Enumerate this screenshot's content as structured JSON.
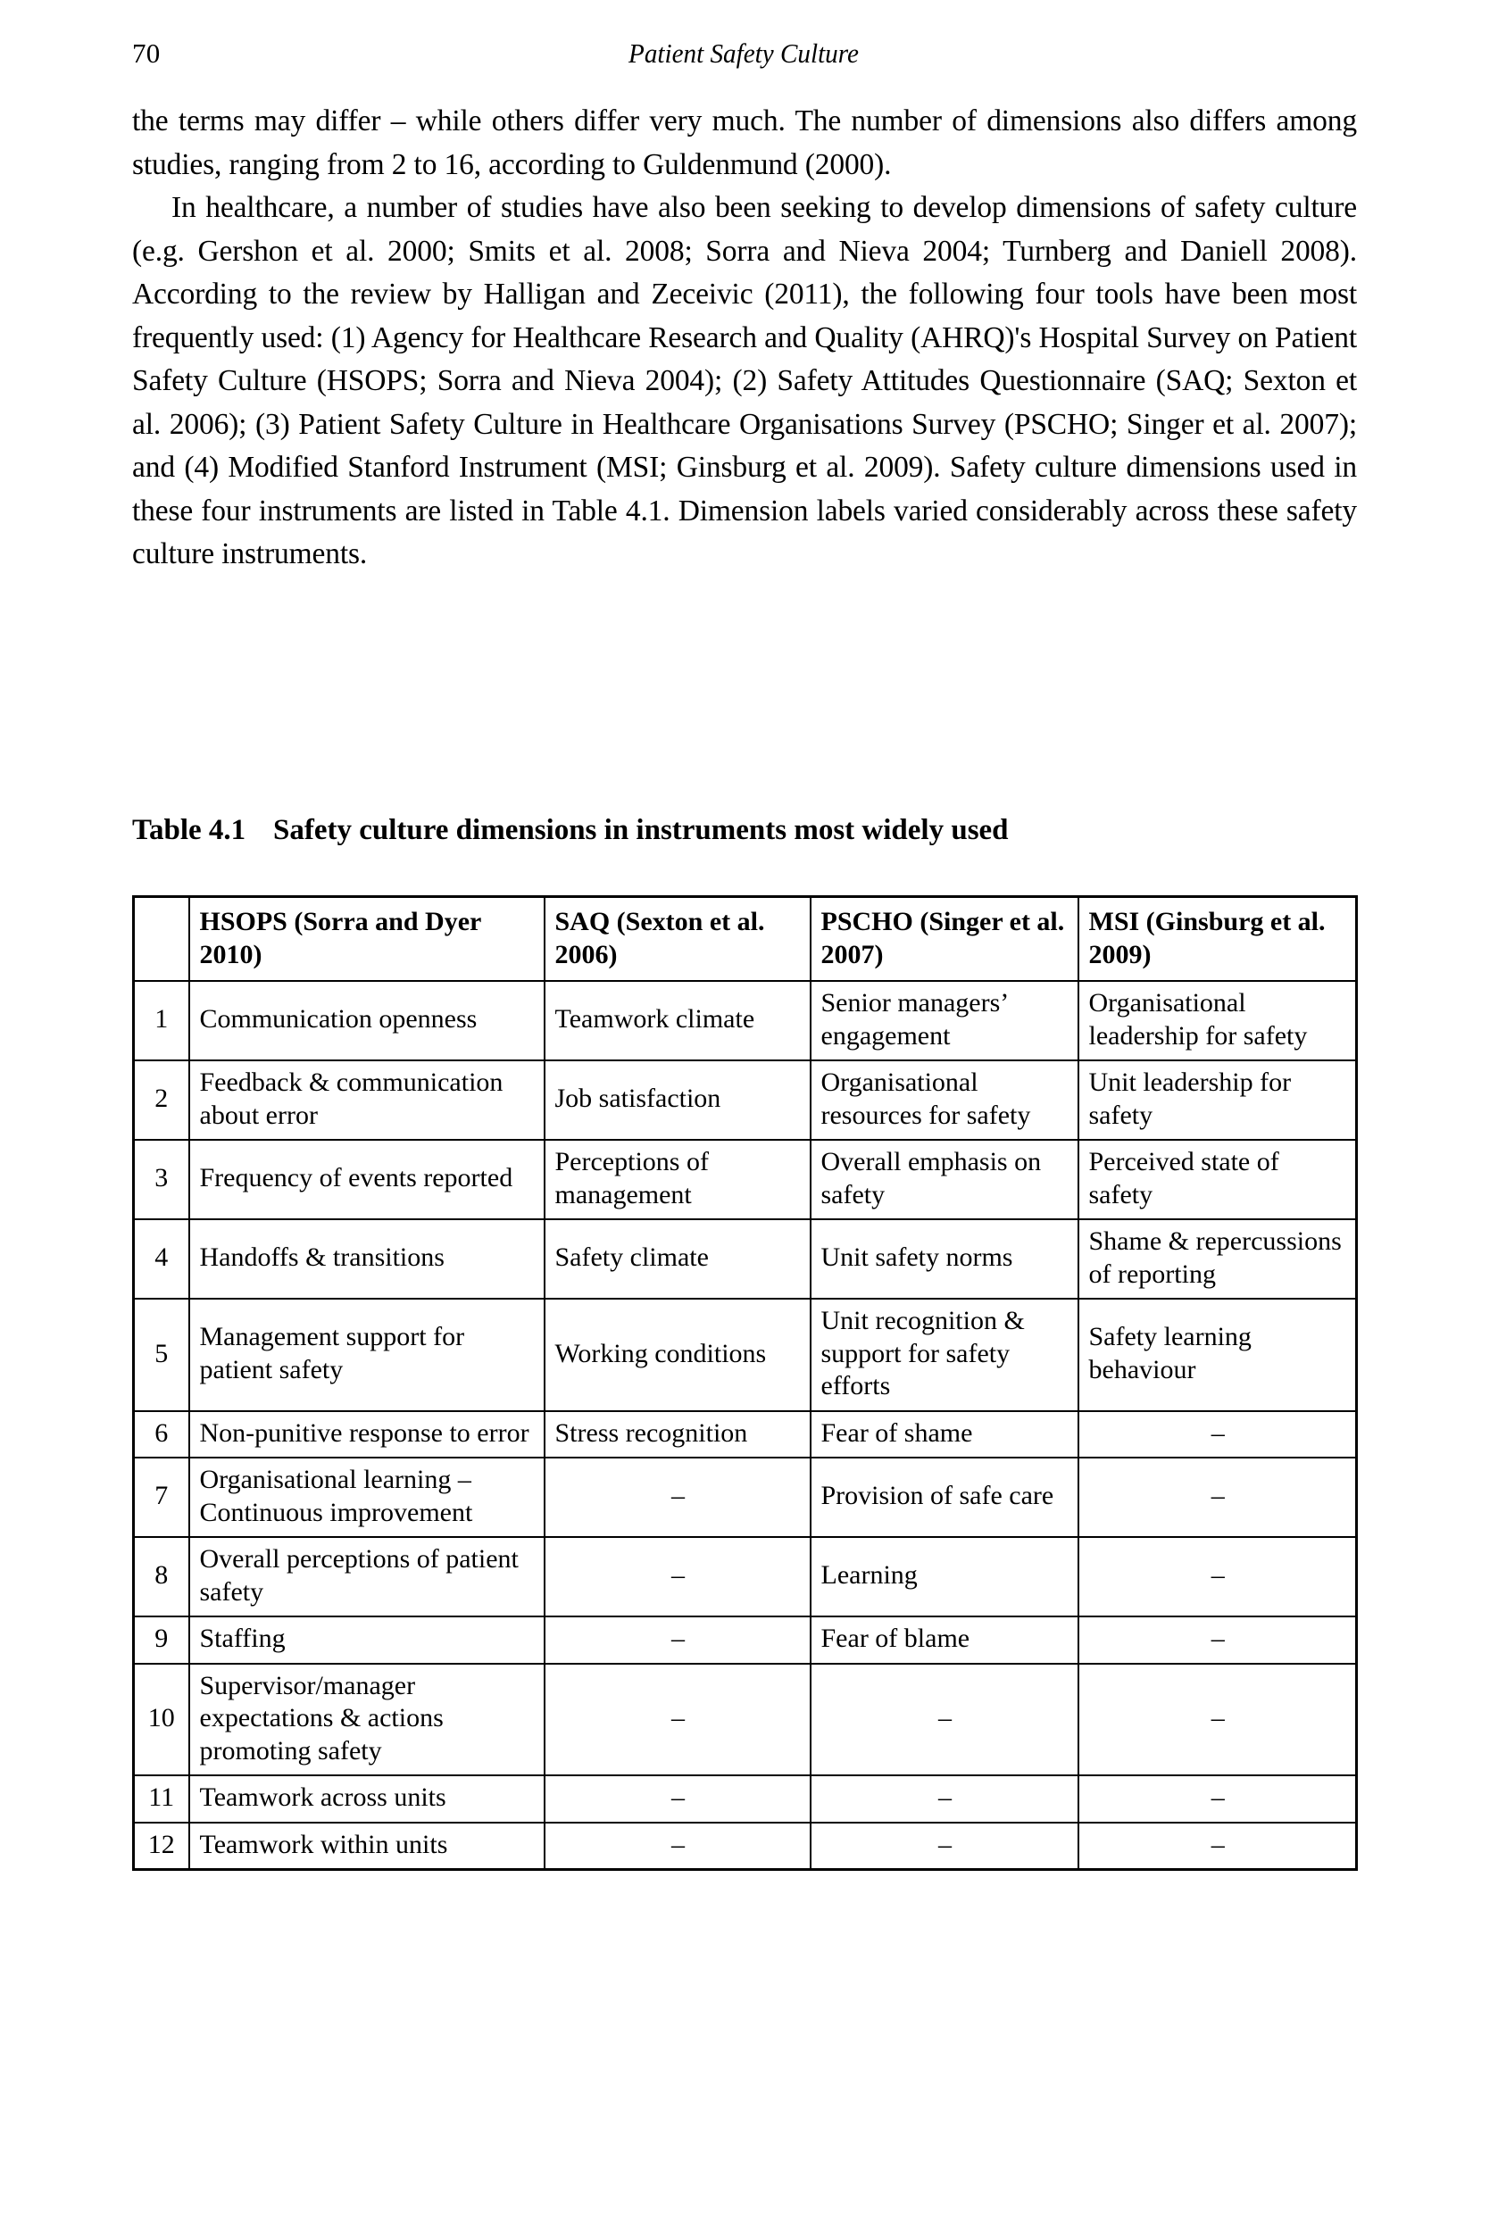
{
  "header": {
    "page_number": "70",
    "running_title": "Patient Safety Culture"
  },
  "body": {
    "paragraph_1": "the terms may differ – while others differ very much. The number of dimensions also differs among studies, ranging from 2 to 16, according to Guldenmund (2000).",
    "paragraph_2": "In healthcare, a number of studies have also been seeking to develop dimensions of safety culture (e.g. Gershon et al. 2000; Smits et al. 2008; Sorra and Nieva 2004; Turnberg and Daniell 2008). According to the review by Halligan and Zeceivic (2011), the following four tools have been most frequently used: (1) Agency for Healthcare Research and Quality (AHRQ)'s Hospital Survey on Patient Safety Culture (HSOPS; Sorra and Nieva 2004); (2) Safety Attitudes Questionnaire (SAQ; Sexton et al. 2006); (3) Patient Safety Culture in Healthcare Organisations Survey (PSCHO; Singer et al. 2007); and (4) Modified Stanford Instrument (MSI; Ginsburg et al. 2009). Safety culture dimensions used in these four instruments are listed in Table 4.1. Dimension labels varied considerably across these safety culture instruments."
  },
  "table": {
    "caption_number": "Table 4.1",
    "caption_text": "Safety culture dimensions in instruments most widely used",
    "columns": [
      {
        "key": "num",
        "label": ""
      },
      {
        "key": "hsops",
        "label": "HSOPS (Sorra and Dyer 2010)"
      },
      {
        "key": "saq",
        "label": "SAQ (Sexton et al. 2006)"
      },
      {
        "key": "pscho",
        "label": "PSCHO (Singer et al. 2007)"
      },
      {
        "key": "msi",
        "label": "MSI (Ginsburg et al. 2009)"
      }
    ],
    "rows": [
      {
        "num": "1",
        "hsops": "Communication openness",
        "saq": "Teamwork climate",
        "pscho": "Senior managers’ engagement",
        "msi": "Organisational leadership for safety"
      },
      {
        "num": "2",
        "hsops": "Feedback & communication about error",
        "saq": "Job satisfaction",
        "pscho": "Organisational resources for safety",
        "msi": "Unit leadership for safety"
      },
      {
        "num": "3",
        "hsops": "Frequency of events reported",
        "saq": "Perceptions of management",
        "pscho": "Overall emphasis on safety",
        "msi": "Perceived state of safety"
      },
      {
        "num": "4",
        "hsops": "Handoffs & transitions",
        "saq": "Safety climate",
        "pscho": "Unit safety norms",
        "msi": "Shame & repercussions of reporting"
      },
      {
        "num": "5",
        "hsops": "Management support for patient safety",
        "saq": "Working conditions",
        "pscho": "Unit recognition & support for safety efforts",
        "msi": "Safety learning behaviour"
      },
      {
        "num": "6",
        "hsops": "Non-punitive response to error",
        "saq": "Stress recognition",
        "pscho": "Fear of shame",
        "msi": "–"
      },
      {
        "num": "7",
        "hsops": "Organisational learning – Continuous improvement",
        "saq": "–",
        "pscho": "Provision of safe care",
        "msi": "–"
      },
      {
        "num": "8",
        "hsops": "Overall perceptions of patient safety",
        "saq": "–",
        "pscho": "Learning",
        "msi": "–"
      },
      {
        "num": "9",
        "hsops": "Staffing",
        "saq": "–",
        "pscho": "Fear of blame",
        "msi": "–"
      },
      {
        "num": "10",
        "hsops": "Supervisor/manager expectations & actions promoting safety",
        "saq": "–",
        "pscho": "–",
        "msi": "–"
      },
      {
        "num": "11",
        "hsops": "Teamwork across units",
        "saq": "–",
        "pscho": "–",
        "msi": "–"
      },
      {
        "num": "12",
        "hsops": "Teamwork within units",
        "saq": "–",
        "pscho": "–",
        "msi": "–"
      }
    ]
  }
}
